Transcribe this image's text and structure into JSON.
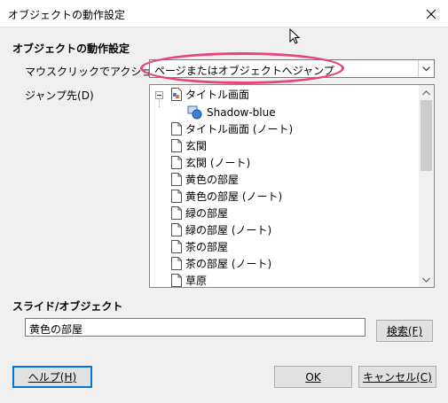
{
  "window": {
    "title": "オブジェクトの動作設定",
    "close_icon": "close-icon"
  },
  "section_action": {
    "heading": "オブジェクトの動作設定",
    "action_label": "マウスクリックでアクション(A)",
    "action_value": "ページまたはオブジェクトへジャンプ",
    "jump_label": "ジャンプ先(D)"
  },
  "tree": {
    "items": [
      {
        "label": "タイトル画面",
        "icon": "slide-icon"
      },
      {
        "label": "Shadow-blue",
        "icon": "shape-object-icon"
      },
      {
        "label": "タイトル画面 (ノート)",
        "icon": "page-icon"
      },
      {
        "label": "玄関",
        "icon": "page-icon"
      },
      {
        "label": "玄関 (ノート)",
        "icon": "page-icon"
      },
      {
        "label": "黄色の部屋",
        "icon": "page-icon"
      },
      {
        "label": "黄色の部屋 (ノート)",
        "icon": "page-icon"
      },
      {
        "label": "緑の部屋",
        "icon": "page-icon"
      },
      {
        "label": "緑の部屋 (ノート)",
        "icon": "page-icon"
      },
      {
        "label": "茶の部屋",
        "icon": "page-icon"
      },
      {
        "label": "茶の部屋 (ノート)",
        "icon": "page-icon"
      },
      {
        "label": "草原",
        "icon": "page-icon"
      }
    ]
  },
  "section_slide": {
    "heading": "スライド/オブジェクト",
    "input_value": "黄色の部屋",
    "search_button": "検索(F)"
  },
  "footer": {
    "help_button": "ヘルプ(H)",
    "ok_button": "OK",
    "cancel_button": "キャンセル(C)"
  },
  "colors": {
    "highlight": "#e8437e",
    "focus": "#0078d7"
  }
}
